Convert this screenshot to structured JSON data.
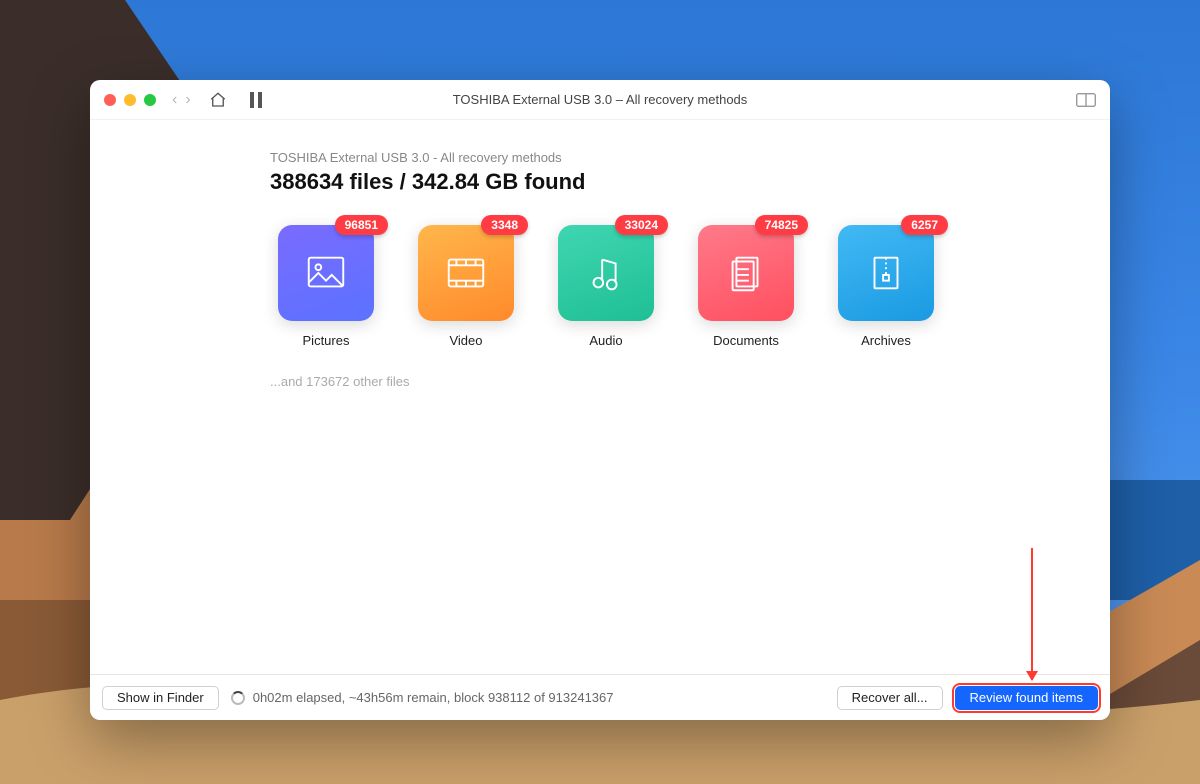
{
  "window_title": "TOSHIBA External USB 3.0 – All recovery methods",
  "breadcrumb": "TOSHIBA External USB 3.0 - All recovery methods",
  "headline": "388634 files / 342.84 GB found",
  "categories": [
    {
      "name": "pictures",
      "label": "Pictures",
      "count": "96851"
    },
    {
      "name": "video",
      "label": "Video",
      "count": "3348"
    },
    {
      "name": "audio",
      "label": "Audio",
      "count": "33024"
    },
    {
      "name": "documents",
      "label": "Documents",
      "count": "74825"
    },
    {
      "name": "archives",
      "label": "Archives",
      "count": "6257"
    }
  ],
  "other_files_text": "...and 173672 other files",
  "footer": {
    "show_in_finder": "Show in Finder",
    "status": "0h02m elapsed, ~43h56m remain, block 938112 of 913241367",
    "recover_all": "Recover all...",
    "review": "Review found items"
  }
}
